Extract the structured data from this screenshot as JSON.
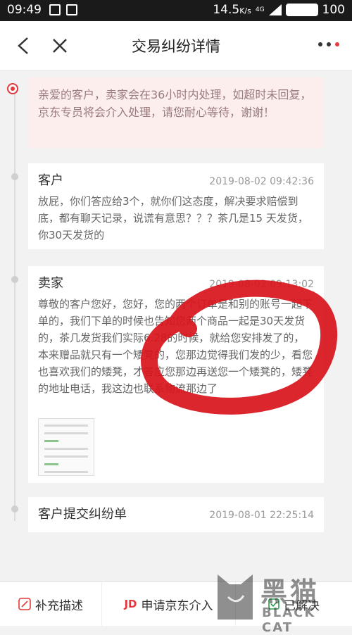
{
  "status_bar": {
    "time": "09:49",
    "speed": "14.5",
    "speed_unit": "K/s",
    "network": "4G",
    "battery": "100"
  },
  "header": {
    "title": "交易纠纷详情"
  },
  "notice": {
    "text": "亲爱的客户，卖家会在36小时内处理，如超时未回复，京东专员将会介入处理，请您耐心等待，谢谢！"
  },
  "messages": [
    {
      "author": "客户",
      "time": "2019-08-02 09:42:36",
      "text": "放屁，你们答应给3个，就你们这态度，解决要求赔偿到底，都有聊天记录，说谎有意思？？？茶几是15 天发货，你30天发货的"
    },
    {
      "author": "卖家",
      "time": "2019-08-02 09:13:02",
      "text": "尊敬的客户您好，您好，您的两个订单是和别的账号一起下单的，我们下单的时候也告知您两个商品一起是30天发货的，茶几发货我们实际6.28的时候，就给您安排发了的，本来赠品就只有一个矮凳的，您那边觉得我们发的少，看您也喜欢我们的矮凳，才答应您那边再送您一个矮凳的，矮凳的地址电话，我这边也联系物流那边了"
    },
    {
      "author": "客户提交纠纷单",
      "time": "2019-08-01 22:25:14"
    }
  ],
  "bottom_bar": {
    "supplement": "补充描述",
    "jd_logo": "JD",
    "apply_jd": "申请京东介入",
    "resolved": "已解决"
  },
  "watermark": {
    "cn": "黑猫",
    "en": "BLACK CAT"
  },
  "colors": {
    "accent": "#e4393c",
    "notice_bg": "#fdeeee",
    "scribble": "#d8141b"
  }
}
